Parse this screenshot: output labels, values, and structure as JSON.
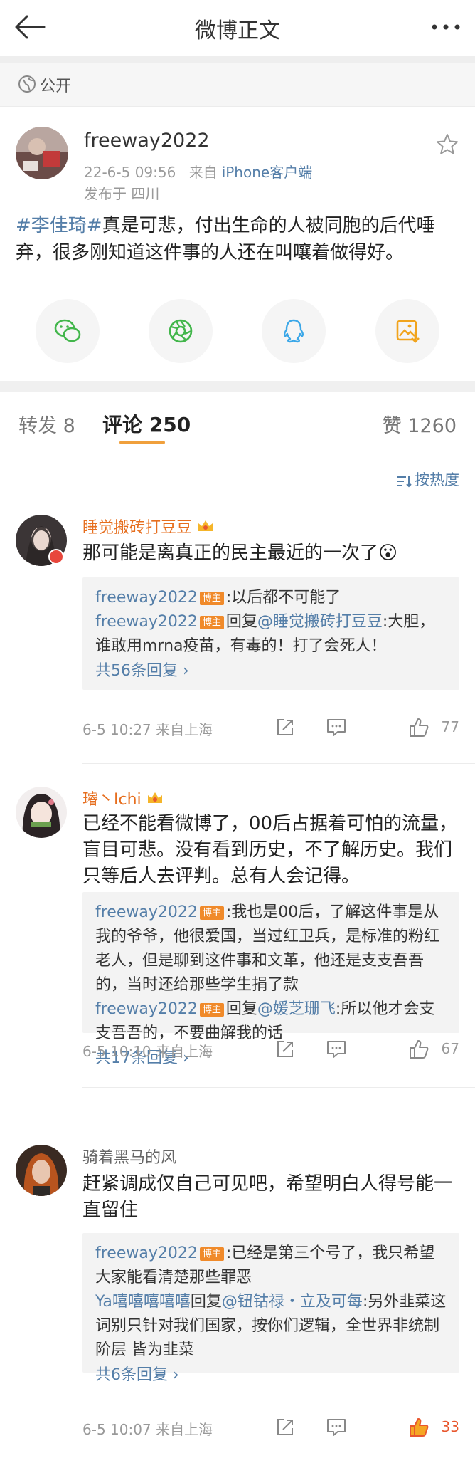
{
  "header": {
    "title": "微博正文"
  },
  "privacy": {
    "label": "公开"
  },
  "post": {
    "author": "freeway2022",
    "time": "22-6-5 09:56",
    "from_prefix": "来自",
    "source": "iPhone客户端",
    "location": "发布于 四川",
    "hashtag": "#李佳琦#",
    "text": "真是可悲，付出生命的人被同胞的后代唾弃，很多刚知道这件事的人还在叫嚷着做得好。"
  },
  "share_buttons": [
    "wechat-icon",
    "moments-icon",
    "qq-icon",
    "save-image-icon"
  ],
  "tabs": {
    "repost": "转发 8",
    "comments": "评论 250",
    "likes": "赞 1260"
  },
  "sort": {
    "label": "按热度"
  },
  "colors": {
    "link": "#547ea8",
    "vip_name": "#e66e1e",
    "accent": "#f0a03c",
    "like_active": "#e8572e"
  },
  "comments": [
    {
      "name": "睡觉搬砖打豆豆",
      "text": "那可能是离真正的民主最近的一次了😮",
      "replies": [
        {
          "user": "freeway2022",
          "badge": "博主",
          "text": ":以后都不可能了"
        },
        {
          "user": "freeway2022",
          "badge": "博主",
          "prefix": "回复",
          "mention": "@睡觉搬砖打豆豆",
          "text": ":大胆，谁敢用mrna疫苗，有毒的！打了会死人！"
        }
      ],
      "more": "共56条回复 ›",
      "time": "6-5 10:27 来自上海",
      "likes": "77"
    },
    {
      "name": "璿丶Ichi",
      "text": "已经不能看微博了，00后占据着可怕的流量，盲目可悲。没有看到历史，不了解历史。我们只等后人去评判。总有人会记得。",
      "replies": [
        {
          "user": "freeway2022",
          "badge": "博主",
          "text": ":我也是00后，了解这件事是从我的爷爷，他很爱国，当过红卫兵，是标准的粉红老人，但是聊到这件事和文革，他还是支支吾吾的，当时还给那些学生捐了款"
        },
        {
          "user": "freeway2022",
          "badge": "博主",
          "prefix": "回复",
          "mention": "@媛芝珊飞",
          "text": ":所以他才会支支吾吾的，不要曲解我的话"
        }
      ],
      "more": "共17条回复 ›",
      "time": "6-5 10:10 来自上海",
      "likes": "67"
    },
    {
      "name": "骑着黑马的风",
      "text": "赶紧调成仅自己可见吧，希望明白人得号能一直留住",
      "replies": [
        {
          "user": "freeway2022",
          "badge": "博主",
          "text": ":已经是第三个号了，我只希望大家能看清楚那些罪恶"
        },
        {
          "user": "Ya嘻嘻嘻嘻嘻",
          "prefix": "回复",
          "mention": "@钮钴禄・立及可每",
          "text": ":另外韭菜这词别只针对我们国家，按你们逻辑，全世界非统制阶层 皆为韭菜"
        }
      ],
      "more": "共6条回复 ›",
      "time": "6-5 10:07 来自上海",
      "likes": "33"
    }
  ]
}
